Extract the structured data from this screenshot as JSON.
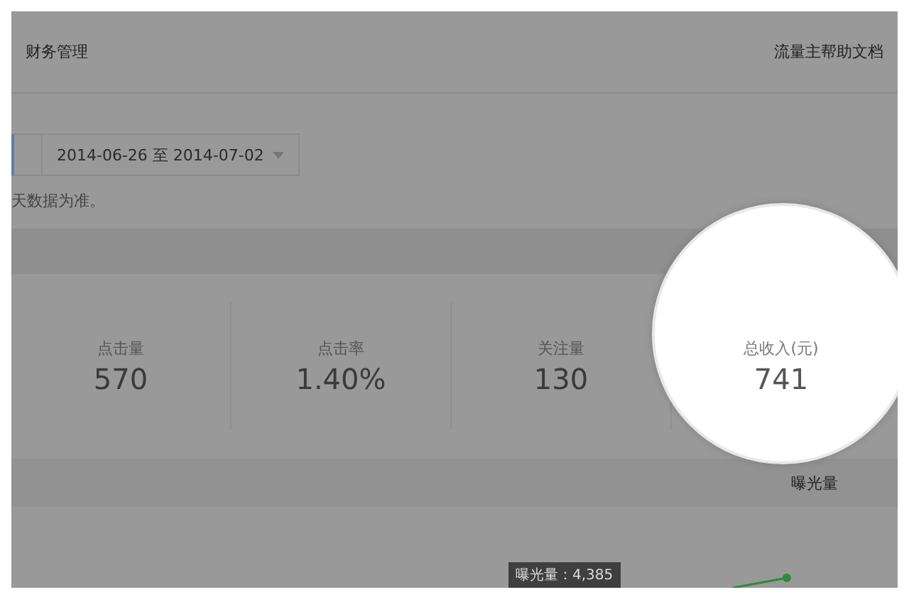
{
  "nav": {
    "left": "财务管理",
    "right": "流量主帮助文档"
  },
  "date_range": {
    "value": "2014-06-26 至 2014-07-02"
  },
  "note": "天数据为准。",
  "stats": [
    {
      "label": "点击量",
      "value": "570",
      "highlighted": false
    },
    {
      "label": "点击率",
      "value": "1.40%",
      "highlighted": false
    },
    {
      "label": "关注量",
      "value": "130",
      "highlighted": false
    },
    {
      "label": "总收入(元)",
      "value": "741",
      "highlighted": true
    }
  ],
  "chart": {
    "legend": "曝光量",
    "tooltip": "曝光量：4,385"
  }
}
